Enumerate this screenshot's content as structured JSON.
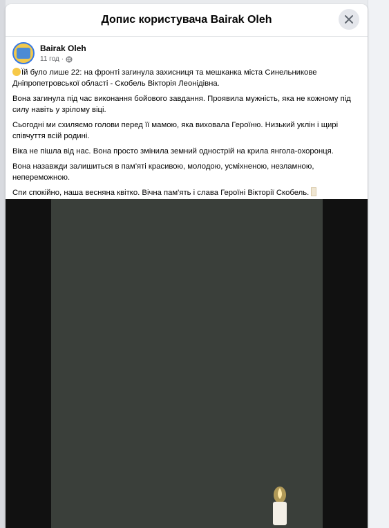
{
  "dialog": {
    "title": "Допис користувача Bairak Oleh",
    "close_icon": "close-icon"
  },
  "post": {
    "author": "Bairak Oleh",
    "time": "11 год",
    "paragraphs": [
      "Їй було лише 22: на фронті загинула захисниця та мешканка міста Синельникове Дніпропетровської області - Скобель Вікторія Леонідівна.",
      "Вона загинула під час виконання бойового завдання. Проявила мужність, яка не кожному під силу навіть у зрілому віці.",
      "Сьогодні ми схиляємо голови перед її мамою, яка виховала Героїню. Низький уклін і щирі співчуття всій родині.",
      "Віка не пішла від нас. Вона просто змінила земний однострій на крила янгола-охоронця.",
      "Вона назавжди залишиться в пам'яті красивою, молодою, усміхненою, незламною, непереможною.",
      "Спи спокійно, наша весняна квітко. Вічна пам'ять і слава Героїні Вікторії Скобель."
    ]
  },
  "media": {
    "background_color": "#111111",
    "candle_icon": "candle-icon"
  },
  "colors": {
    "text": "#050505",
    "secondary_text": "#65676b",
    "close_button_bg": "#e4e6eb"
  }
}
